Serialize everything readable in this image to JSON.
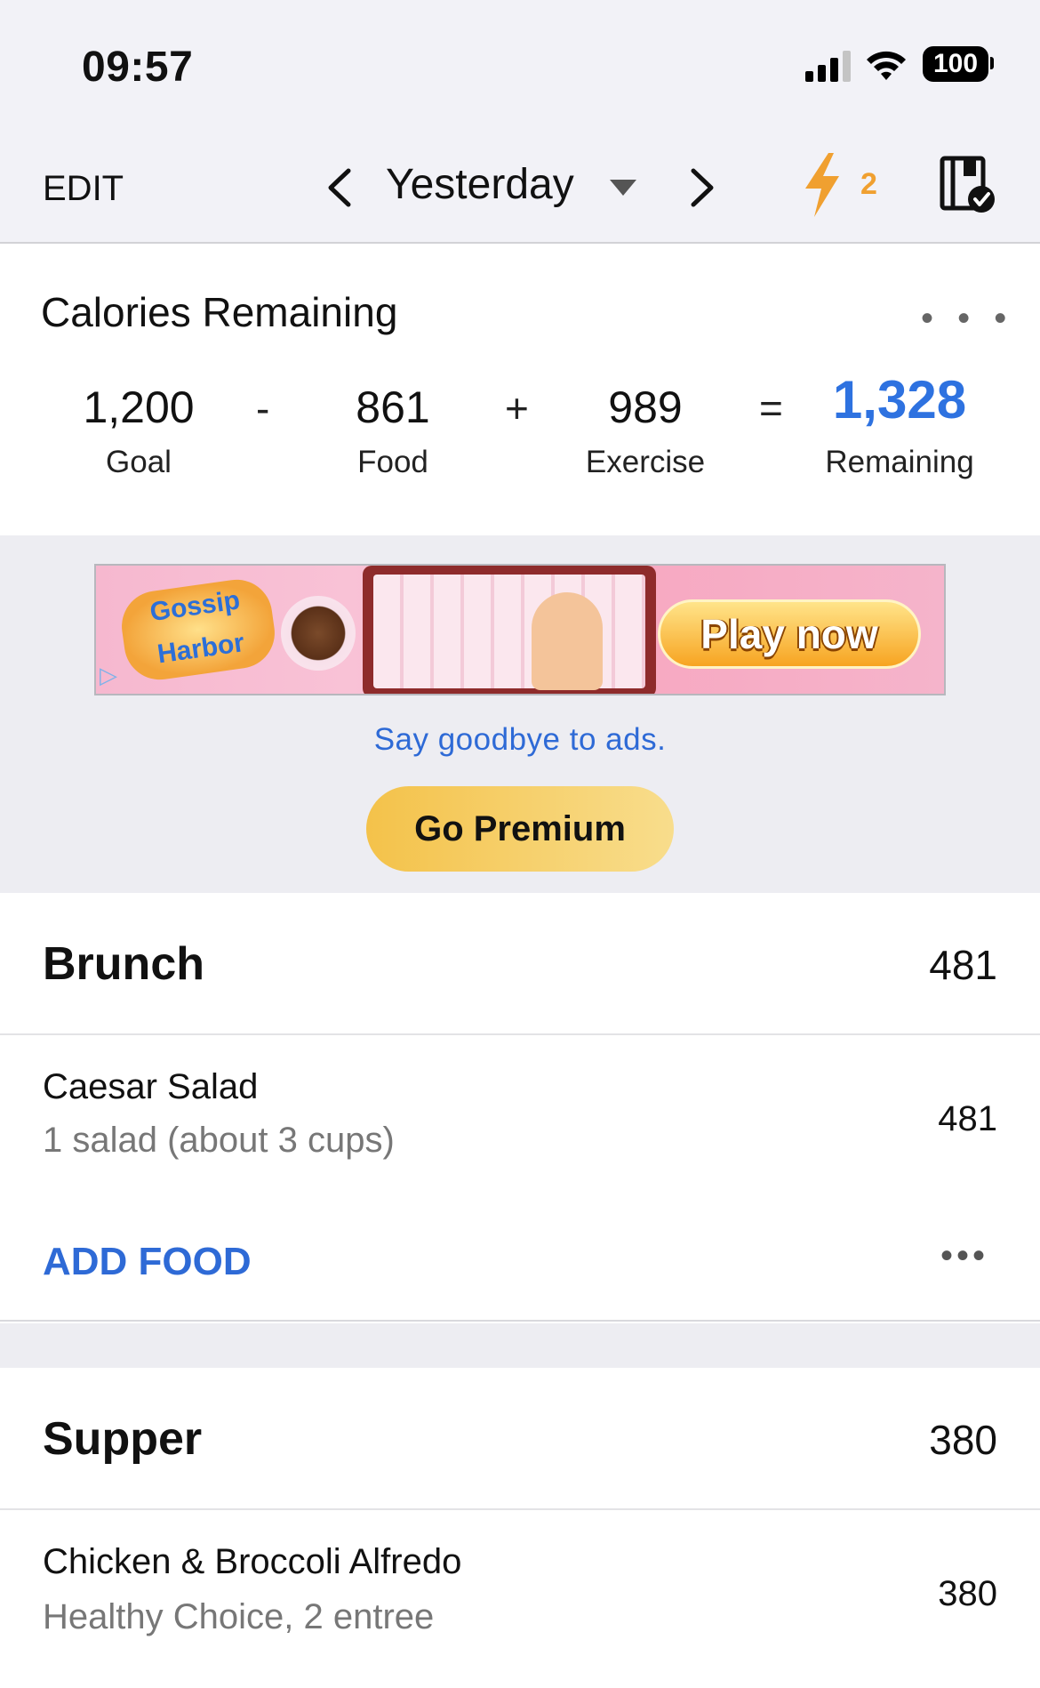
{
  "status_bar": {
    "time": "09:57",
    "battery": "100"
  },
  "nav": {
    "edit_label": "EDIT",
    "date_label": "Yesterday",
    "streak_count": "2"
  },
  "calories": {
    "title": "Calories Remaining",
    "more": "• • •",
    "goal_value": "1,200",
    "goal_label": "Goal",
    "minus": "-",
    "food_value": "861",
    "food_label": "Food",
    "plus": "+",
    "exercise_value": "989",
    "exercise_label": "Exercise",
    "equals": "=",
    "remaining_value": "1,328",
    "remaining_label": "Remaining",
    "remaining_color": "#2e72e0"
  },
  "ad": {
    "logo_text": "Gossip Harbor",
    "play_label": "Play now",
    "goodbye_text": "Say goodbye to ads.",
    "premium_label": "Go Premium"
  },
  "meals": [
    {
      "name": "Brunch",
      "total": "481",
      "foods": [
        {
          "name": "Caesar Salad",
          "detail": "1 salad (about 3 cups)",
          "calories": "481"
        }
      ],
      "add_label": "ADD FOOD",
      "more": "•••"
    },
    {
      "name": "Supper",
      "total": "380",
      "foods": [
        {
          "name": "Chicken & Broccoli Alfredo",
          "detail": "Healthy Choice, 2 entree",
          "calories": "380"
        }
      ]
    }
  ],
  "colors": {
    "accent_blue": "#2e6ad6",
    "streak_orange": "#f0a030",
    "premium_gold": "#f4c24a"
  }
}
